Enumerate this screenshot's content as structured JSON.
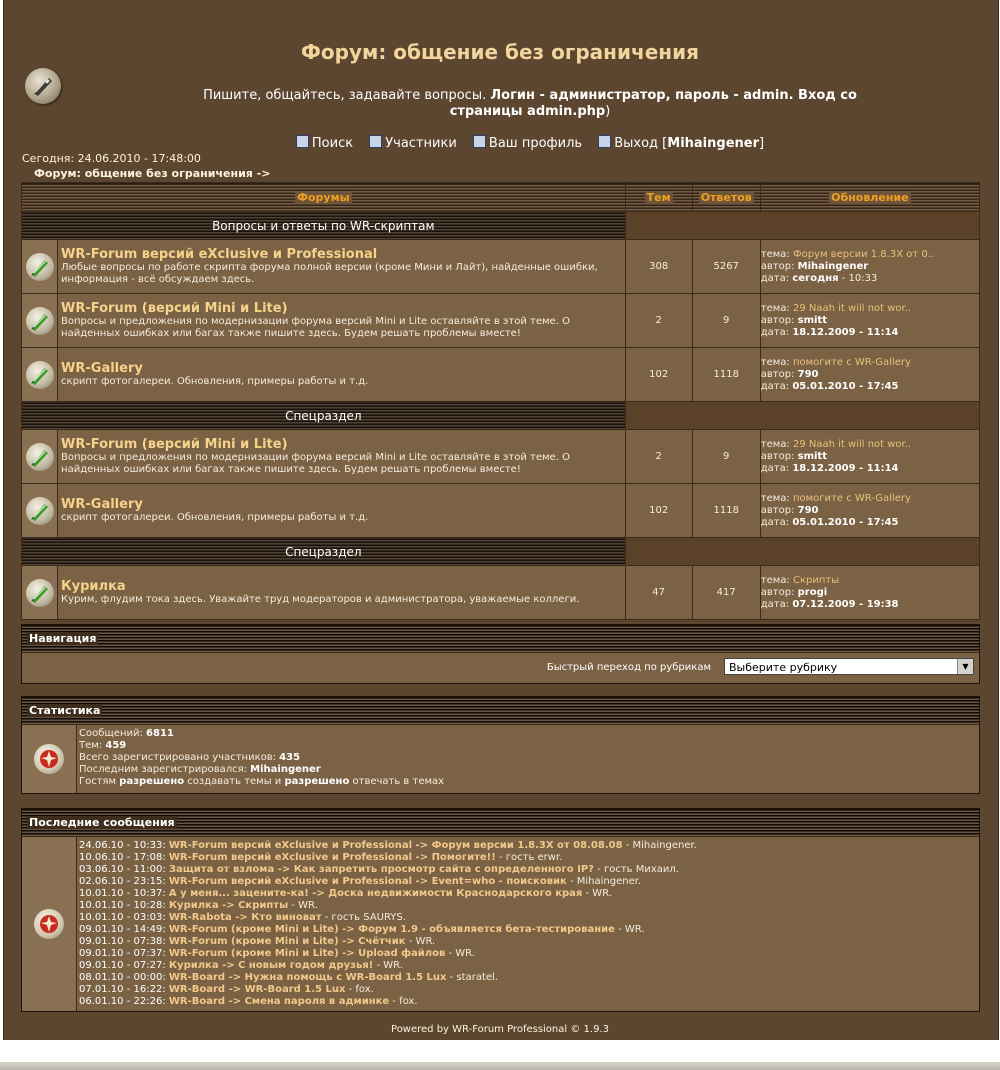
{
  "header": {
    "title": "Форум: общение без ограничения",
    "desc_plain": "Пишите, общайтесь, задавайте вопросы. ",
    "desc_bold": "Логин - администратор, пароль - admin. Вход со страницы admin.php",
    "desc_end": ")"
  },
  "topnav": {
    "search": "Поиск",
    "members": "Участники",
    "profile": "Ваш профиль",
    "logout": "Выход",
    "username": "Mihaingener"
  },
  "today": "Сегодня: 24.06.2010 - 17:48:00",
  "breadcrumb": "Форум: общение без ограничения ->",
  "table_headers": {
    "forums": "Форумы",
    "topics": "Тем",
    "replies": "Ответов",
    "updated": "Обновление"
  },
  "categories": [
    {
      "title": "Вопросы и ответы по WR-скриптам",
      "forums": [
        {
          "name": "WR-Forum версий eXclusive и Professional",
          "desc": "Любые вопросы по работе скрипта форума полной версии (кроме Мини и Лайт), найденные ошибки, информация - всё обсуждаем здесь.",
          "topics": "308",
          "replies": "5267",
          "topic_label": "тема:",
          "topic": "Форум версии 1.8.3X от 0..",
          "author_label": "автор:",
          "author": "Mihaingener",
          "date_label": "дата:",
          "date": "сегодня",
          "time": " - 10:33"
        },
        {
          "name": "WR-Forum (версий Mini и Lite)",
          "desc": "Вопросы и предложения по модернизации форума версий Mini и Lite оставляйте в этой теме. О найденных ошибках или багах также пишите здесь. Будем решать проблемы вместе!",
          "topics": "2",
          "replies": "9",
          "topic_label": "тема:",
          "topic": "29 Naah it will not wor..",
          "author_label": "автор:",
          "author": "smitt",
          "date_label": "дата:",
          "date": "18.12.2009 - 11:14",
          "time": ""
        },
        {
          "name": "WR-Gallery",
          "desc": "скрипт фотогалереи. Обновления, примеры работы и т.д.",
          "topics": "102",
          "replies": "1118",
          "topic_label": "тема:",
          "topic": "помогите с WR-Gallery",
          "author_label": "автор:",
          "author": "790",
          "date_label": "дата:",
          "date": "05.01.2010 - 17:45",
          "time": ""
        }
      ]
    },
    {
      "title": "Спецраздел",
      "forums": [
        {
          "name": "WR-Forum (версий Mini и Lite)",
          "desc": "Вопросы и предложения по модернизации форума версий Mini и Lite оставляйте в этой теме. О найденных ошибках или багах также пишите здесь. Будем решать проблемы вместе!",
          "topics": "2",
          "replies": "9",
          "topic_label": "тема:",
          "topic": "29 Naah it will not wor..",
          "author_label": "автор:",
          "author": "smitt",
          "date_label": "дата:",
          "date": "18.12.2009 - 11:14",
          "time": ""
        },
        {
          "name": "WR-Gallery",
          "desc": "скрипт фотогалереи. Обновления, примеры работы и т.д.",
          "topics": "102",
          "replies": "1118",
          "topic_label": "тема:",
          "topic": "помогите с WR-Gallery",
          "author_label": "автор:",
          "author": "790",
          "date_label": "дата:",
          "date": "05.01.2010 - 17:45",
          "time": ""
        }
      ]
    },
    {
      "title": "Спецраздел",
      "forums": [
        {
          "name": "Курилка",
          "desc": "Курим, флудим тока здесь. Уважайте труд модераторов и администратора, уважаемые коллеги.",
          "topics": "47",
          "replies": "417",
          "topic_label": "тема:",
          "topic": "Скрипты",
          "author_label": "автор:",
          "author": "progi",
          "date_label": "дата:",
          "date": "07.12.2009 - 19:38",
          "time": ""
        }
      ]
    }
  ],
  "navigation": {
    "title": "Навигация",
    "quick_jump_label": "Быстрый переход по рубрикам",
    "select_value": "Выберите рубрику"
  },
  "stats": {
    "title": "Статистика",
    "messages_label": "Сообщений: ",
    "messages": "6811",
    "topics_label": "Тем: ",
    "topics": "459",
    "members_label": "Всего зарегистрировано участников: ",
    "members": "435",
    "last_label": "Последним зарегистрировался: ",
    "last": "Mihaingener",
    "guests_a": "Гостям ",
    "guests_b": "разрешено",
    "guests_c": " создавать темы и ",
    "guests_d": "разрешено",
    "guests_e": " отвечать в темах"
  },
  "recent": {
    "title": "Последние сообщения",
    "items": [
      {
        "time": "24.06.10 - 10:33:",
        "text": "WR-Forum версий eXclusive и Professional -> Форум версии 1.8.3X от 08.08.08",
        "by": " - Mihaingener."
      },
      {
        "time": "10.06.10 - 17:08:",
        "text": "WR-Forum версий eXclusive и Professional -> Помогите!!",
        "by": " - гость erwr."
      },
      {
        "time": "03.06.10 - 11:00:",
        "text": "Защита от взлома -> Как запретить просмотр сайта с определенного IP?",
        "by": " - гость Михаил."
      },
      {
        "time": "02.06.10 - 23:15:",
        "text": "WR-Forum версий eXclusive и Professional -> Event=who - поисковик",
        "by": " - Mihaingener."
      },
      {
        "time": "10.01.10 - 10:37:",
        "text": "А у меня... зацените-ка! -> Доска недвижимости Краснодарского края",
        "by": " - WR."
      },
      {
        "time": "10.01.10 - 10:28:",
        "text": "Курилка -> Скрипты",
        "by": " - WR."
      },
      {
        "time": "10.01.10 - 03:03:",
        "text": "WR-Rabota -> Кто виноват",
        "by": " - гость SAURYS."
      },
      {
        "time": "09.01.10 - 14:49:",
        "text": "WR-Forum (кроме Mini и Lite) -> Форум 1.9 - объявляется бета-тестирование",
        "by": " - WR."
      },
      {
        "time": "09.01.10 - 07:38:",
        "text": "WR-Forum (кроме Mini и Lite) -> Счётчик",
        "by": " - WR."
      },
      {
        "time": "09.01.10 - 07:37:",
        "text": "WR-Forum (кроме Mini и Lite) -> Upload файлов",
        "by": " - WR."
      },
      {
        "time": "09.01.10 - 07:27:",
        "text": "Курилка -> С новым годом друзья!",
        "by": " - WR."
      },
      {
        "time": "08.01.10 - 00:00:",
        "text": "WR-Board -> Нужна помощь с WR-Board 1.5 Lux",
        "by": " - staratel."
      },
      {
        "time": "07.01.10 - 16:22:",
        "text": "WR-Board -> WR-Board 1.5 Lux",
        "by": " - fox."
      },
      {
        "time": "06.01.10 - 22:26:",
        "text": "WR-Board -> Смена пароля в админке",
        "by": " - fox."
      }
    ]
  },
  "footer": "Powered by WR-Forum Professional © 1.9.3",
  "colors": {
    "background": "#5c4630",
    "row": "#7b6245",
    "header_text": "#f0a020",
    "title_text": "#f2d49d"
  }
}
